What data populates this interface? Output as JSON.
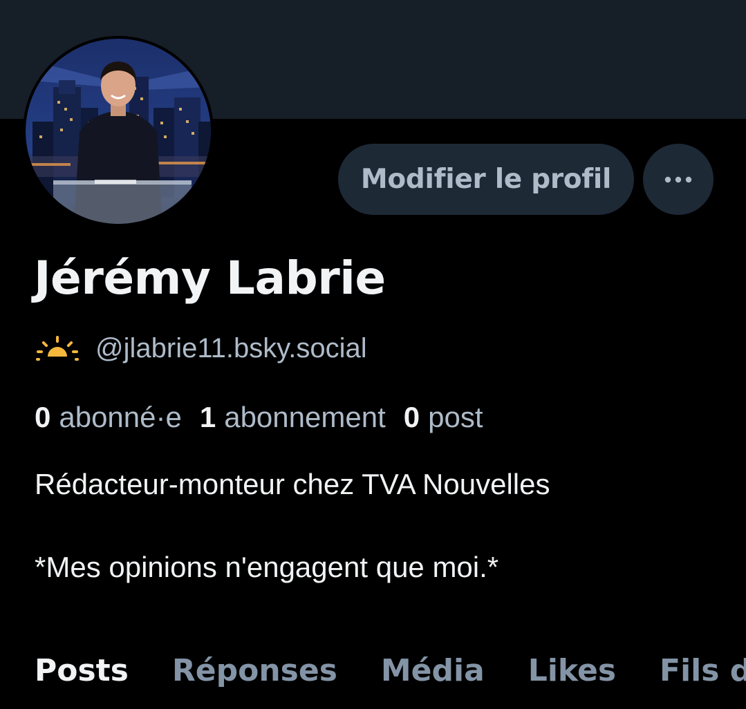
{
  "profile": {
    "display_name": "Jérémy Labrie",
    "handle": "@jlabrie11.bsky.social",
    "avatar_icon": "profile-photo",
    "handle_icon": "sunrise-icon",
    "bio_line1": "Rédacteur-monteur chez TVA Nouvelles",
    "bio_line2": "*Mes opinions n'engagent que moi.*"
  },
  "actions": {
    "edit_label": "Modifier le profil",
    "more_icon": "more-horizontal-icon"
  },
  "stats": {
    "followers_count": "0",
    "followers_label": "abonné·e",
    "following_count": "1",
    "following_label": "abonnement",
    "posts_count": "0",
    "posts_label": "post"
  },
  "tabs": [
    {
      "label": "Posts",
      "active": true
    },
    {
      "label": "Réponses",
      "active": false
    },
    {
      "label": "Média",
      "active": false
    },
    {
      "label": "Likes",
      "active": false
    },
    {
      "label": "Fils d'actualité",
      "active": false
    }
  ],
  "colors": {
    "background": "#000000",
    "banner": "#161e27",
    "button_bg": "#1e2936",
    "primary_text": "#f1f3f5",
    "secondary_text": "#aebbc9",
    "tab_inactive": "#8494a7",
    "sun_icon": "#f5b83d"
  }
}
